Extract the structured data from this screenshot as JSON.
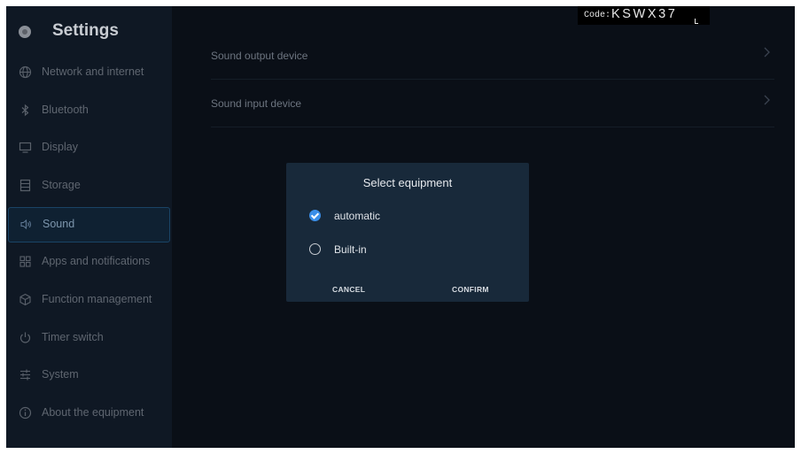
{
  "sidebar": {
    "title": "Settings",
    "items": [
      {
        "label": "Network and internet",
        "icon": "globe-icon"
      },
      {
        "label": "Bluetooth",
        "icon": "bluetooth-icon"
      },
      {
        "label": "Display",
        "icon": "monitor-icon"
      },
      {
        "label": "Storage",
        "icon": "storage-icon"
      },
      {
        "label": "Sound",
        "icon": "speaker-icon",
        "active": true
      },
      {
        "label": "Apps and notifications",
        "icon": "apps-grid-icon"
      },
      {
        "label": "Function management",
        "icon": "cube-icon"
      },
      {
        "label": "Timer switch",
        "icon": "power-icon"
      },
      {
        "label": "System",
        "icon": "sliders-icon"
      },
      {
        "label": "About the equipment",
        "icon": "info-icon"
      }
    ]
  },
  "main": {
    "rows": [
      {
        "label": "Sound output device"
      },
      {
        "label": "Sound input device"
      }
    ]
  },
  "code": {
    "label": "Code:",
    "value": "KSWX37"
  },
  "dialog": {
    "title": "Select equipment",
    "options": [
      {
        "label": "automatic",
        "selected": true
      },
      {
        "label": "Built-in",
        "selected": false
      }
    ],
    "cancel": "CANCEL",
    "confirm": "CONFIRM"
  },
  "colors": {
    "accent": "#3a8ee8",
    "background": "#0a0f17",
    "sidebar": "#0f1824",
    "dialog": "#18293a"
  }
}
